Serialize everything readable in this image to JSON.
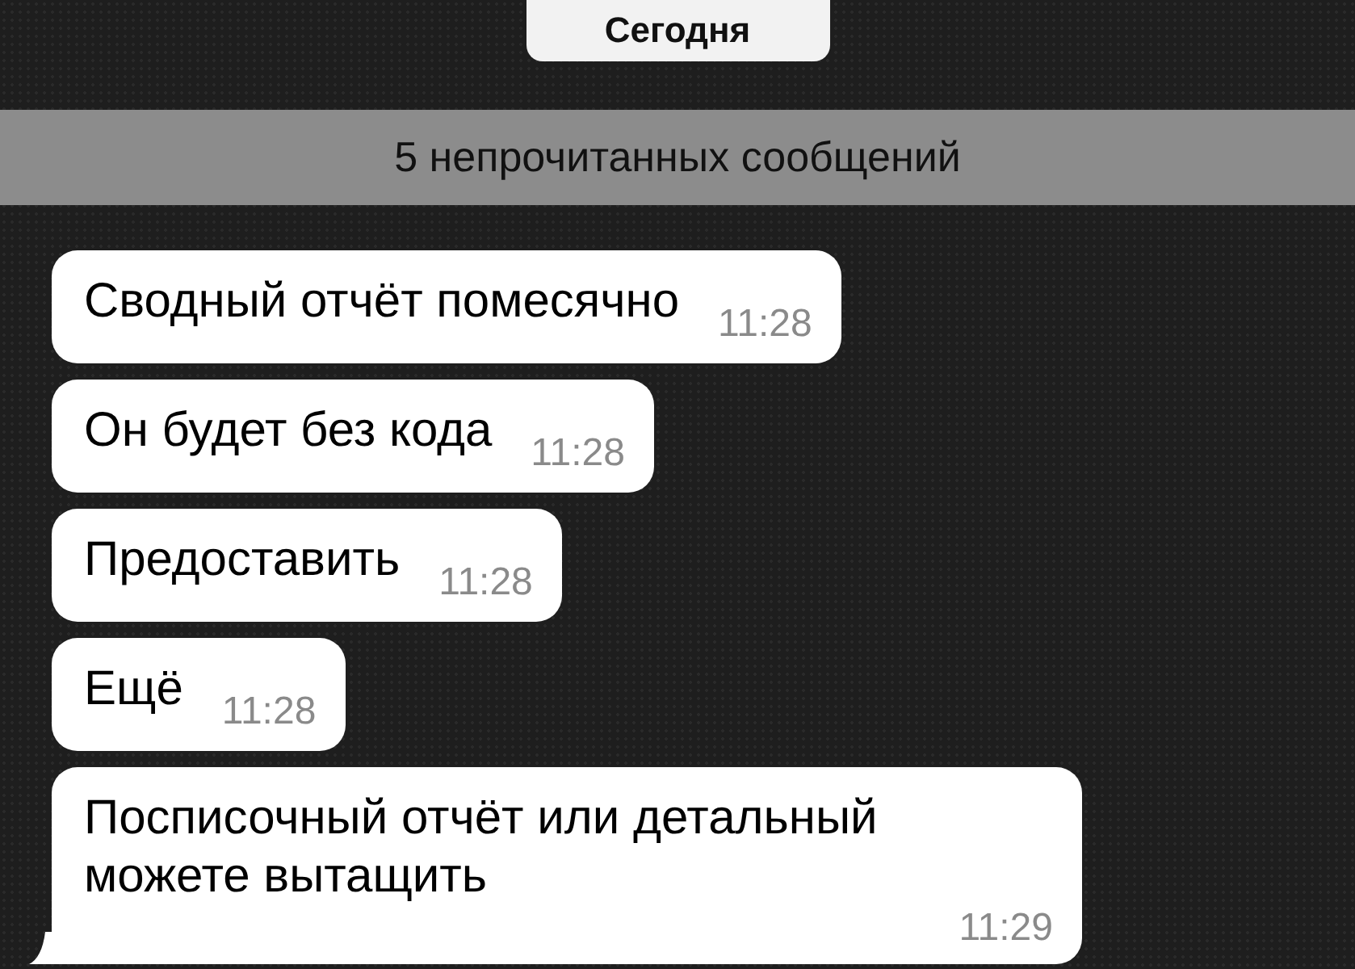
{
  "date_label": "Сегодня",
  "unread_banner": "5 непрочитанных сообщений",
  "messages": [
    {
      "text": "Сводный отчёт помесячно",
      "time": "11:28",
      "tail": false
    },
    {
      "text": "Он будет без кода",
      "time": "11:28",
      "tail": false
    },
    {
      "text": "Предоставить",
      "time": "11:28",
      "tail": false
    },
    {
      "text": "Ещё",
      "time": "11:28",
      "tail": false
    },
    {
      "text": "Посписочный отчёт или детальный можете вытащить",
      "time": "11:29",
      "tail": true
    }
  ]
}
